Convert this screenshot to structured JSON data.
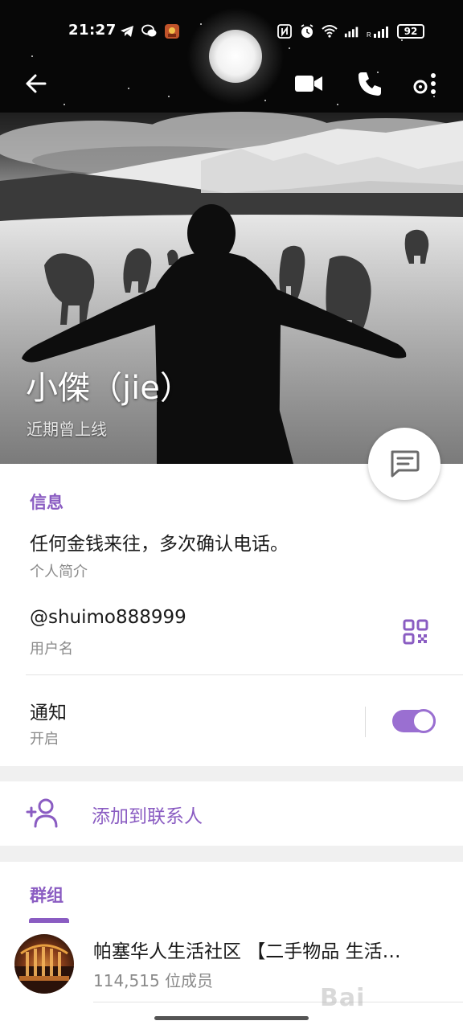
{
  "status_bar": {
    "time": "21:27",
    "battery": "92",
    "left_icons": [
      "telegram-icon",
      "wechat-icon",
      "game-app-icon"
    ],
    "right_icons": [
      "nfc-icon",
      "alarm-icon",
      "wifi-icon",
      "signal-icon",
      "signal-roaming-icon"
    ]
  },
  "topbar": {
    "actions": [
      "back-arrow-icon",
      "video-call-icon",
      "phone-call-icon",
      "more-options-icon"
    ]
  },
  "profile": {
    "name": "小傑（jie）",
    "status": "近期曾上线"
  },
  "info": {
    "section_title": "信息",
    "bio": "任何金钱来往，多次确认电话。",
    "bio_label": "个人简介",
    "username": "@shuimo888999",
    "username_label": "用户名",
    "notifications": "通知",
    "notifications_state": "开启",
    "notifications_on": true
  },
  "add_contact": {
    "label": "添加到联系人"
  },
  "groups": {
    "section_title": "群组",
    "items": [
      {
        "name": "帕塞华人生活社区 【二手物品 生活…",
        "members": "114,515 位成员"
      }
    ]
  },
  "watermark": "Bai",
  "colors": {
    "accent": "#8a5cc2",
    "toggle": "#9a6fd1"
  }
}
